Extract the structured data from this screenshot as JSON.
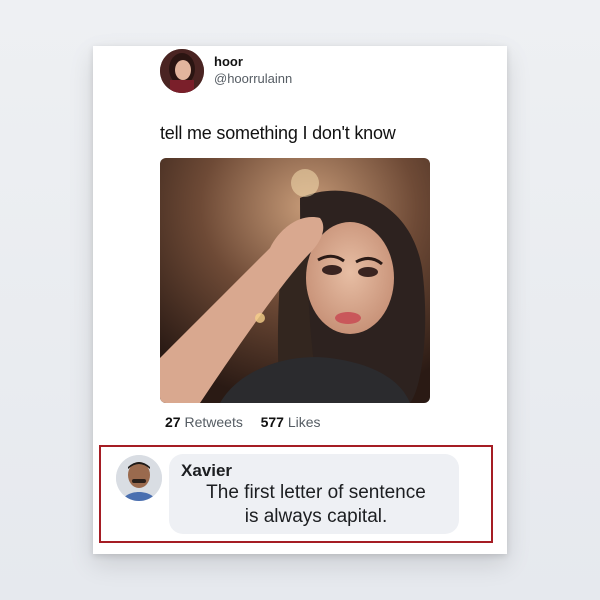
{
  "tweet": {
    "author": {
      "name": "hoor",
      "handle": "@hoorrulainn"
    },
    "text": "tell me something I don't know",
    "stats": {
      "retweets_count": "27",
      "retweets_label": "Retweets",
      "likes_count": "577",
      "likes_label": "Likes"
    }
  },
  "reply": {
    "author_name": "Xavier",
    "line1": "The first letter of sentence",
    "line2": "is always capital."
  },
  "colors": {
    "highlight_border": "#a51d24",
    "bubble_bg": "#eef0f4"
  }
}
